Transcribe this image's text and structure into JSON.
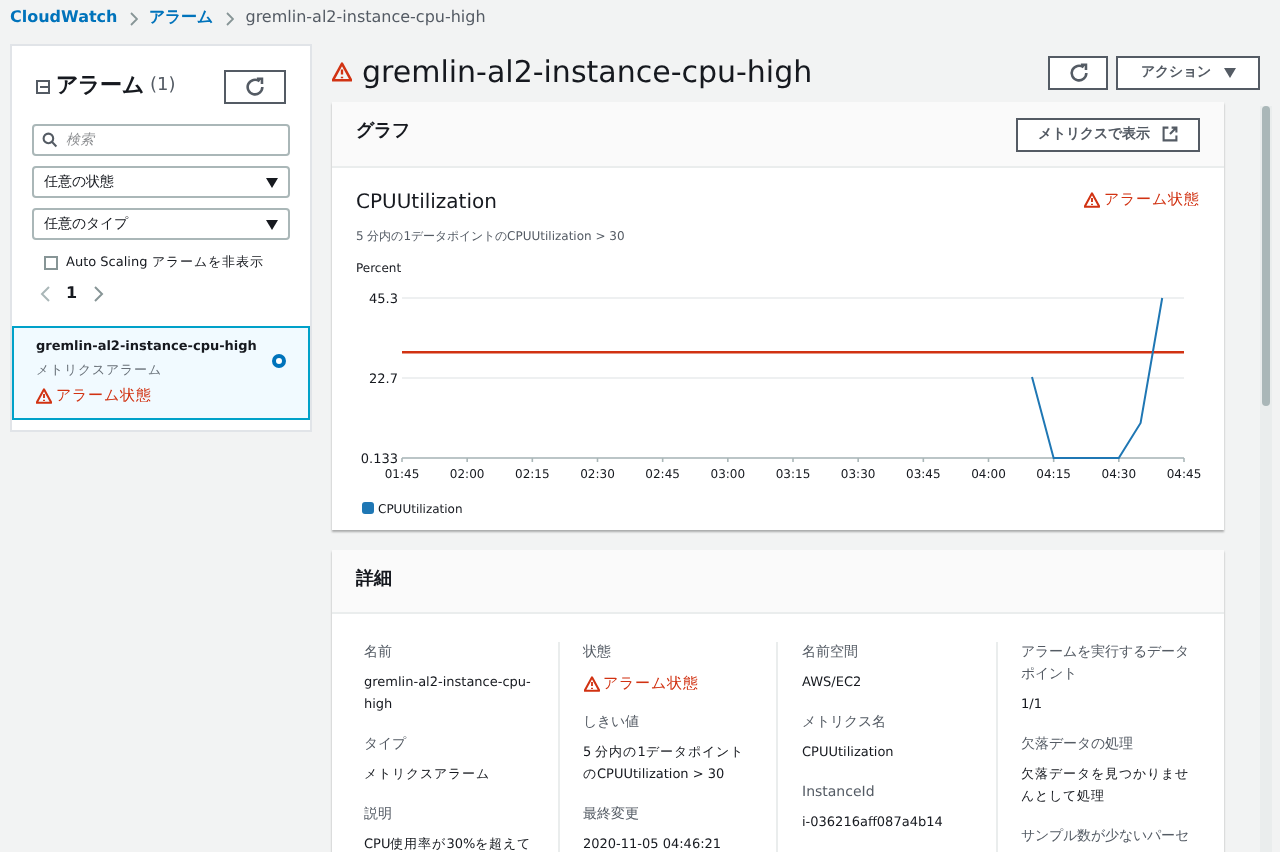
{
  "breadcrumb": [
    {
      "label": "CloudWatch",
      "link": true
    },
    {
      "label": "アラーム",
      "link": true
    },
    {
      "label": "gremlin-al2-instance-cpu-high",
      "link": false
    }
  ],
  "sidebar": {
    "title": "アラーム",
    "count": "(1)",
    "search": {
      "placeholder": "検索"
    },
    "filters": [
      {
        "label": "任意の状態"
      },
      {
        "label": "任意のタイプ"
      }
    ],
    "hide_autoscaling": {
      "label": "Auto Scaling アラームを非表示",
      "checked": false
    },
    "page": "1",
    "items": [
      {
        "name": "gremlin-al2-instance-cpu-high",
        "type": "メトリクスアラーム",
        "state": "アラーム状態",
        "selected": true
      }
    ]
  },
  "title": "gremlin-al2-instance-cpu-high",
  "actions_button": "アクション",
  "graph_panel": {
    "heading": "グラフ",
    "view_button": "メトリクスで表示",
    "chart_title": "CPUUtilization",
    "subtitle": "5 分内の1データポイントのCPUUtilization > 30",
    "state": "アラーム状態",
    "chart_data": {
      "type": "line",
      "ylabel": "Percent",
      "categories": [
        "01:45",
        null,
        null,
        "02:00",
        null,
        null,
        "02:15",
        null,
        null,
        "02:30",
        null,
        null,
        "02:45",
        null,
        null,
        "03:00",
        null,
        null,
        "03:15",
        null,
        null,
        "03:30",
        null,
        null,
        "03:45",
        null,
        null,
        "04:00",
        null,
        null,
        "04:15",
        null,
        null,
        "04:30",
        null,
        null,
        "04:45"
      ],
      "series": [
        {
          "name": "CPUUtilization",
          "color": "#1f77b4",
          "values": [
            null,
            null,
            null,
            null,
            null,
            null,
            null,
            null,
            null,
            null,
            null,
            null,
            null,
            null,
            null,
            null,
            null,
            null,
            null,
            null,
            null,
            null,
            null,
            null,
            null,
            null,
            null,
            null,
            null,
            23,
            0.133,
            0.133,
            0.133,
            0.133,
            10,
            45.3,
            null
          ]
        }
      ],
      "ylim": [
        0.133,
        45.3
      ],
      "yticks": [
        0.133,
        22.7,
        45.3
      ],
      "ref_lines": [
        {
          "axis": "y",
          "value": 30,
          "color": "#d13212"
        }
      ]
    }
  },
  "details_panel": {
    "heading": "詳細",
    "columns": [
      [
        {
          "label": "名前",
          "value": "gremlin-al2-instance-cpu-high",
          "kind": "text"
        },
        {
          "label": "タイプ",
          "value": "メトリクスアラーム",
          "kind": "text"
        },
        {
          "label": "説明",
          "value": "CPU使用率が30%を超えて",
          "kind": "text"
        }
      ],
      [
        {
          "label": "状態",
          "value": "アラーム状態",
          "kind": "status"
        },
        {
          "label": "しきい値",
          "value": "5 分内の1データポイントのCPUUtilization > 30",
          "kind": "text"
        },
        {
          "label": "最終変更",
          "value": "2020-11-05 04:46:21",
          "kind": "text"
        }
      ],
      [
        {
          "label": "名前空間",
          "value": "AWS/EC2",
          "kind": "text"
        },
        {
          "label": "メトリクス名",
          "value": "CPUUtilization",
          "kind": "text"
        },
        {
          "label": "InstanceId",
          "value": "i-036216aff087a4b14",
          "kind": "text"
        }
      ],
      [
        {
          "label": "アラームを実行するデータポイント",
          "value": "1/1",
          "kind": "text"
        },
        {
          "label": "欠落データの処理",
          "value": "欠落データを見つかりませんとして処理",
          "kind": "text"
        },
        {
          "label": "サンプル数が少ないパーセ",
          "kind": "label_only"
        }
      ]
    ]
  }
}
